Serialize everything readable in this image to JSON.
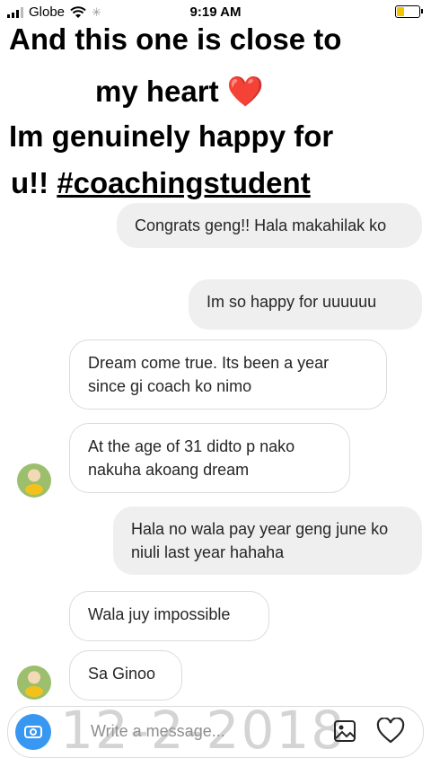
{
  "status_bar": {
    "carrier": "Globe",
    "time": "9:19 AM"
  },
  "story_overlay": {
    "line1": "And this one is close to",
    "line2_text": "my heart",
    "line2_emoji": "❤️",
    "line3": "Im genuinely happy for",
    "line4_prefix": "u!!",
    "line4_tag": "#coachingstudent"
  },
  "messages": [
    {
      "direction": "outgoing",
      "text": "Congrats geng!! Hala makahilak ko"
    },
    {
      "direction": "outgoing",
      "text": "Im so happy for uuuuuu"
    },
    {
      "direction": "incoming",
      "text": "Dream come true. Its been a year since gi coach ko nimo"
    },
    {
      "direction": "incoming",
      "text": "At the age of 31 didto p nako nakuha akoang dream"
    },
    {
      "direction": "outgoing",
      "text": "Hala no wala pay year geng june ko niuli last year hahaha"
    },
    {
      "direction": "incoming",
      "text": "Wala juy impossible"
    },
    {
      "direction": "incoming",
      "text": "Sa Ginoo"
    }
  ],
  "composer": {
    "placeholder": "Write a message...",
    "watermark": "12-2-2018"
  },
  "icons": {
    "camera": "camera-icon",
    "gallery": "gallery-icon",
    "like": "heart-icon"
  },
  "colors": {
    "camera_button": "#3897f0",
    "outgoing_bubble": "#efefef",
    "incoming_border": "#dbdbdb",
    "battery": "#f5c400"
  }
}
